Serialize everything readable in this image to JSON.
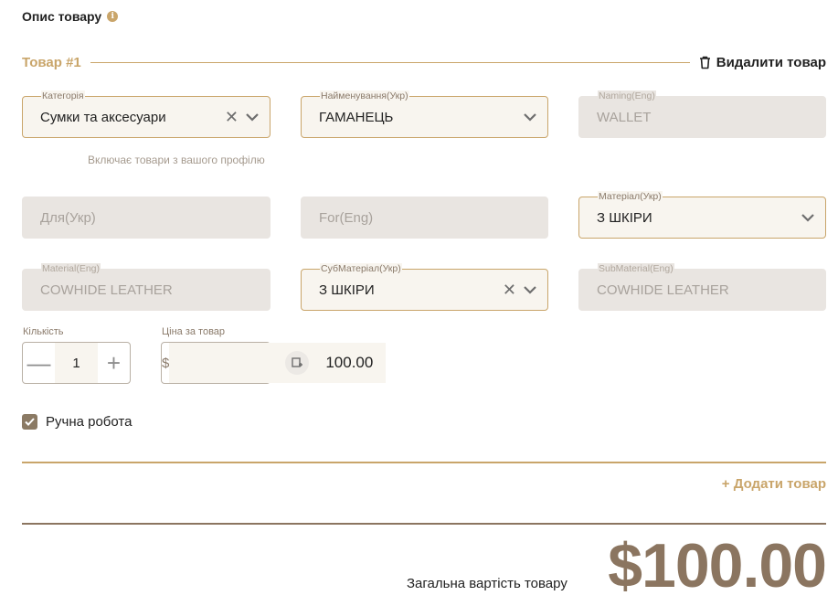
{
  "section": {
    "title": "Опис товару",
    "info_icon": "info-icon"
  },
  "item": {
    "title": "Товар #1",
    "delete_label": "Видалити товар"
  },
  "fields": {
    "category": {
      "label": "Категорія",
      "value": "Сумки та аксесуари",
      "hint": "Включає товари з вашого профілю"
    },
    "name_ukr": {
      "label": "Найменування(Укр)",
      "value": "ГАМАНЕЦЬ"
    },
    "naming_eng": {
      "label": "Naming(Eng)",
      "value": "WALLET"
    },
    "for_ukr": {
      "placeholder": "Для(Укр)"
    },
    "for_eng": {
      "placeholder": "For(Eng)"
    },
    "material_ukr": {
      "label": "Матеріал(Укр)",
      "value": "З ШКІРИ"
    },
    "material_eng": {
      "label": "Material(Eng)",
      "value": "COWHIDE LEATHER"
    },
    "submaterial_ukr": {
      "label": "СубМатеріал(Укр)",
      "value": "З ШКІРИ"
    },
    "submaterial_eng": {
      "label": "SubMaterial(Eng)",
      "value": "COWHIDE LEATHER"
    }
  },
  "quantity": {
    "label": "Кількість",
    "value": "1",
    "minus": "—",
    "plus": "+"
  },
  "price": {
    "label": "Ціна за товар",
    "currency": "$",
    "value": "100.00"
  },
  "handmade": {
    "label": "Ручна робота",
    "checked": true
  },
  "add_item_label": "+ Додати товар",
  "total": {
    "label": "Загальна вартість товару",
    "value": "$100.00"
  },
  "colors": {
    "accent": "#c9a56a",
    "dark_accent": "#8b7560",
    "disabled_bg": "#e9e5e1",
    "active_bg": "#f8f5ef"
  }
}
